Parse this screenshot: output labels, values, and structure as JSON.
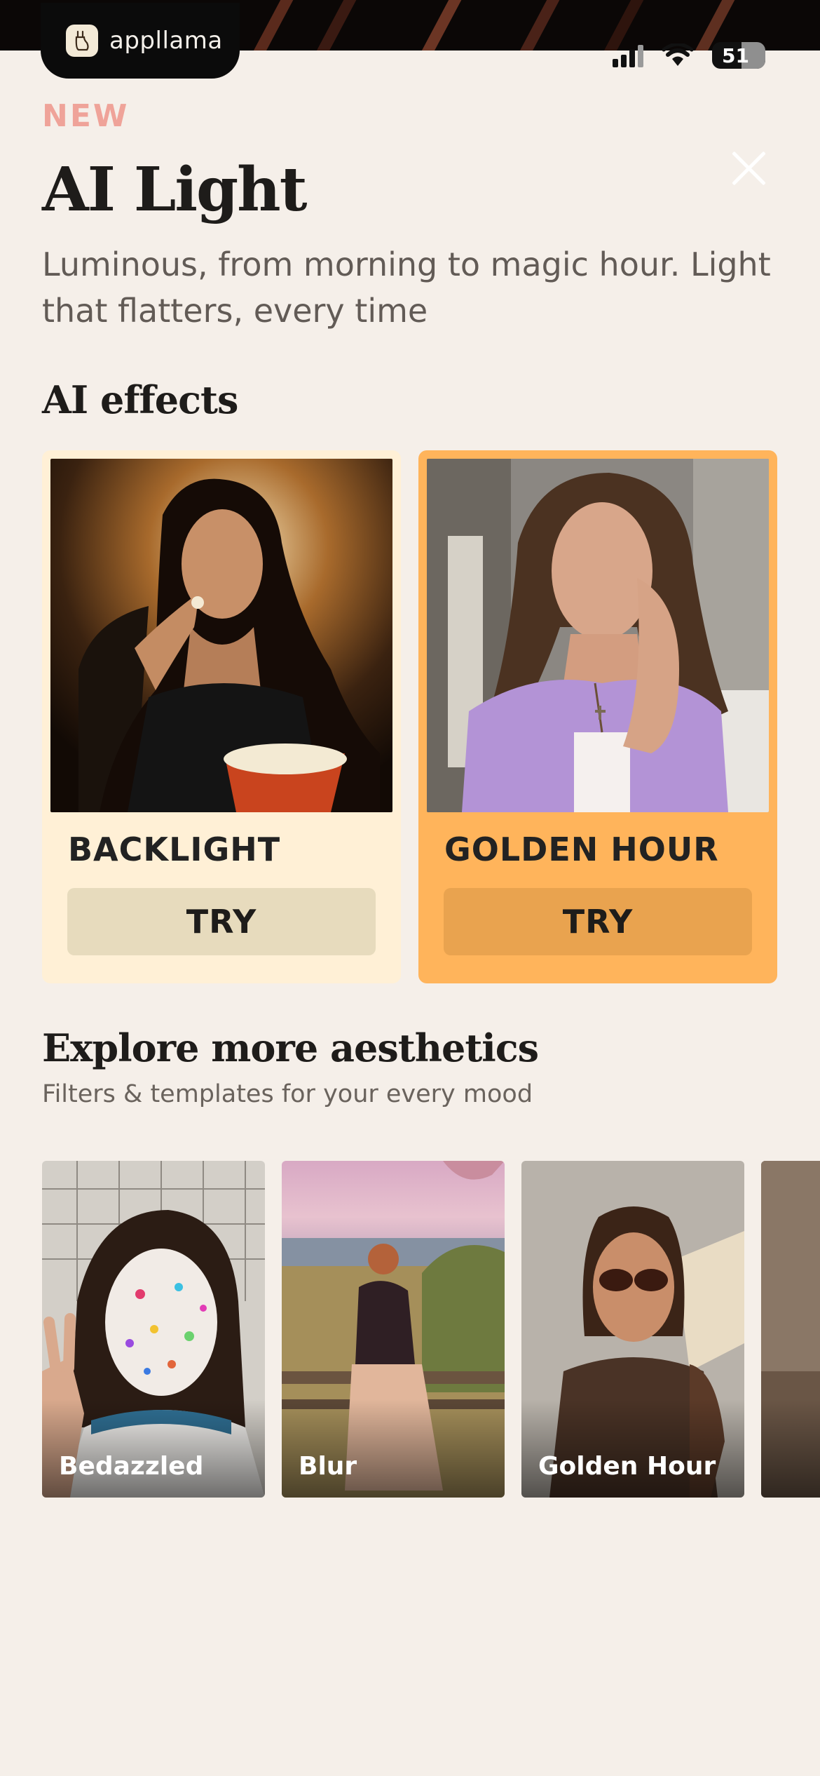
{
  "brand": {
    "name": "appllama"
  },
  "status_bar": {
    "battery": "51"
  },
  "header": {
    "tag": "NEW",
    "title": "AI Light",
    "subtitle": "Luminous, from morning to magic hour. Light that flatters, every time"
  },
  "effects_section": {
    "title": "AI effects",
    "cards": [
      {
        "label": "BACKLIGHT",
        "button": "TRY"
      },
      {
        "label": "GOLDEN HOUR",
        "button": "TRY"
      }
    ]
  },
  "explore_section": {
    "title": "Explore more aesthetics",
    "subtitle": "Filters & templates for your every mood",
    "items": [
      {
        "label": "Bedazzled"
      },
      {
        "label": "Blur"
      },
      {
        "label": "Golden Hour"
      },
      {
        "label": ""
      }
    ]
  },
  "colors": {
    "background": "#f5efe9",
    "new_tag": "#efa399",
    "backlight_card": "#fff0d6",
    "golden_card": "#ffb45b"
  },
  "icons": [
    "appllama-logo-icon",
    "cellular-signal-icon",
    "wifi-icon",
    "battery-icon",
    "close-icon"
  ]
}
